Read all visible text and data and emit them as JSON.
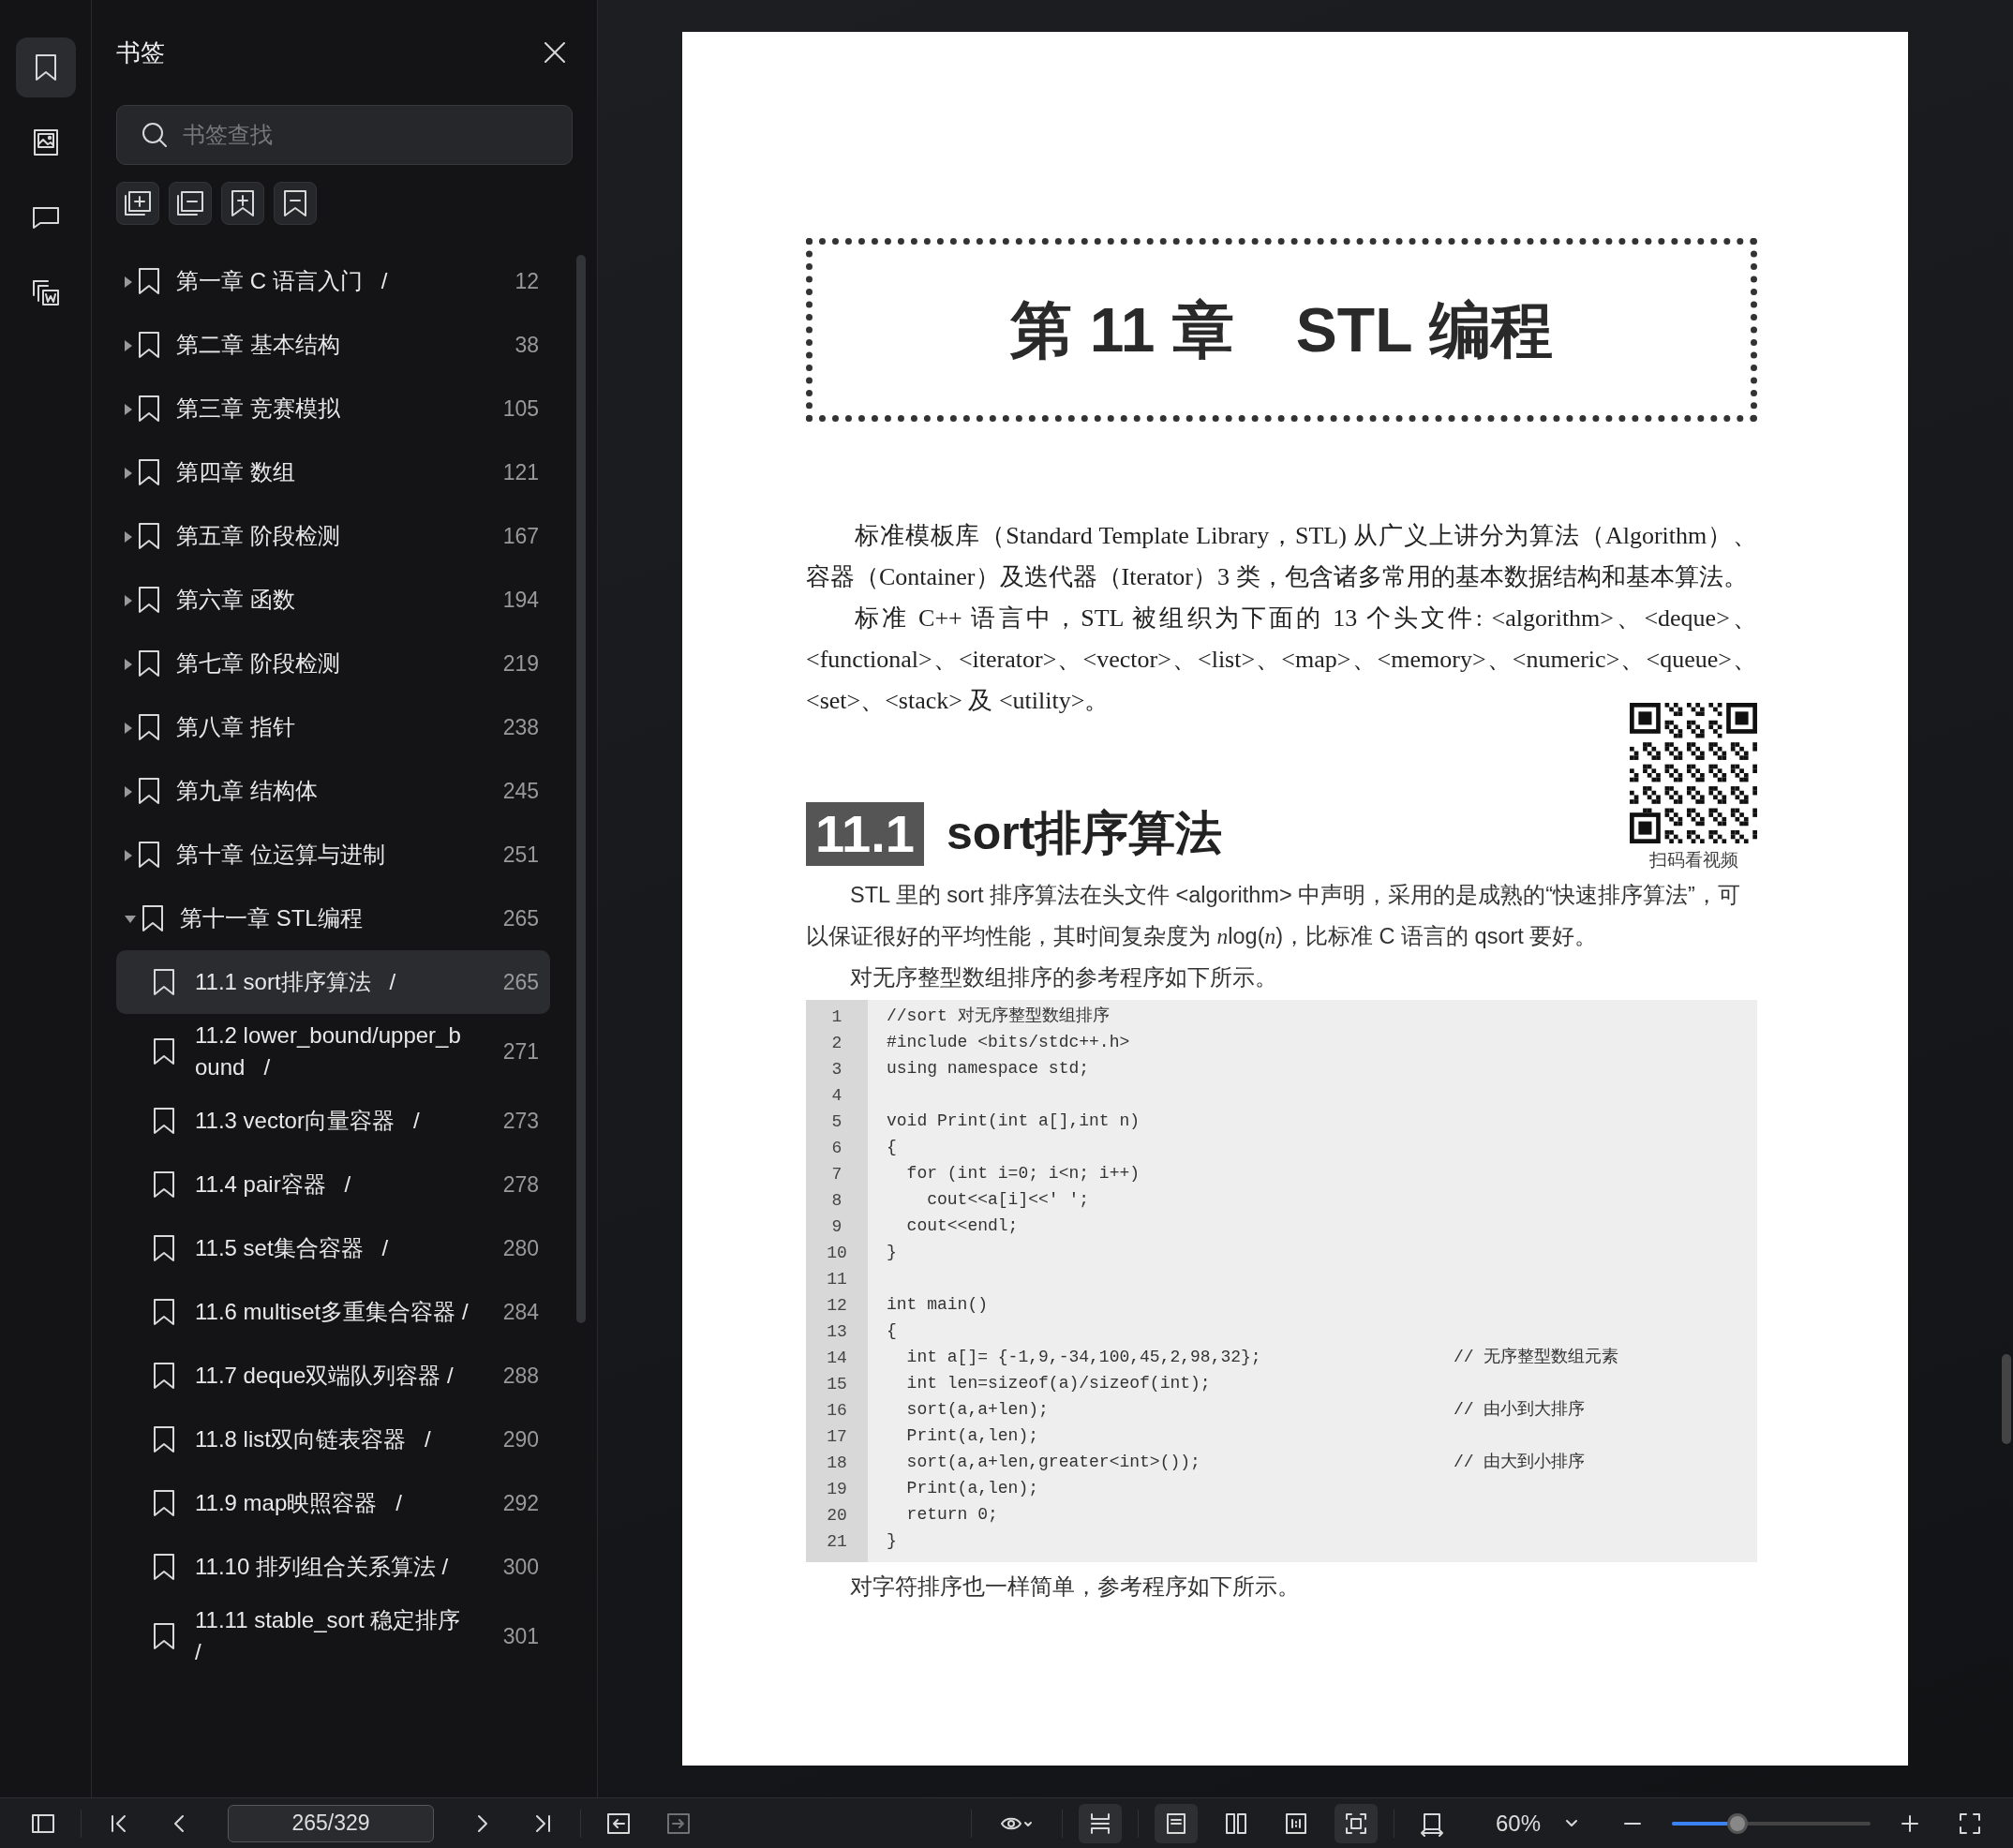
{
  "rail": [
    {
      "kind": "bookmark",
      "selected": true
    },
    {
      "kind": "image",
      "selected": false
    },
    {
      "kind": "comment",
      "selected": false
    },
    {
      "kind": "export",
      "selected": false
    }
  ],
  "sidebar": {
    "title": "书签",
    "search": {
      "placeholder": "书签查找"
    },
    "tools": [
      {
        "kind": "add-group"
      },
      {
        "kind": "remove-group"
      },
      {
        "kind": "add-bookmark"
      },
      {
        "kind": "remove-bookmark"
      }
    ],
    "items": [
      {
        "title": "第一章 C 语言入门   /",
        "page": "12",
        "expanded": false,
        "selected": false
      },
      {
        "title": "第二章 基本结构",
        "page": "38",
        "expanded": false,
        "selected": false
      },
      {
        "title": "第三章 竞赛模拟",
        "page": "105",
        "expanded": false,
        "selected": false
      },
      {
        "title": "第四章 数组",
        "page": "121",
        "expanded": false,
        "selected": false
      },
      {
        "title": "第五章 阶段检测",
        "page": "167",
        "expanded": false,
        "selected": false
      },
      {
        "title": "第六章 函数",
        "page": "194",
        "expanded": false,
        "selected": false
      },
      {
        "title": "第七章 阶段检测",
        "page": "219",
        "expanded": false,
        "selected": false
      },
      {
        "title": "第八章 指针",
        "page": "238",
        "expanded": false,
        "selected": false
      },
      {
        "title": "第九章 结构体",
        "page": "245",
        "expanded": false,
        "selected": false
      },
      {
        "title": "第十章 位运算与进制",
        "page": "251",
        "expanded": false,
        "selected": false
      },
      {
        "title": "第十一章 STL编程",
        "page": "265",
        "expanded": true,
        "selected": false,
        "children": [
          {
            "title": "11.1 sort排序算法   /",
            "page": "265",
            "selected": true
          },
          {
            "title": "11.2 lower_bound/upper_bound   /",
            "page": "271",
            "selected": false
          },
          {
            "title": "11.3 vector向量容器   /",
            "page": "273",
            "selected": false
          },
          {
            "title": "11.4 pair容器   /",
            "page": "278",
            "selected": false
          },
          {
            "title": "11.5 set集合容器   /",
            "page": "280",
            "selected": false
          },
          {
            "title": "11.6 multiset多重集合容器 /",
            "page": "284",
            "selected": false
          },
          {
            "title": "11.7 deque双端队列容器 /",
            "page": "288",
            "selected": false
          },
          {
            "title": "11.8 list双向链表容器   /",
            "page": "290",
            "selected": false
          },
          {
            "title": "11.9 map映照容器   /",
            "page": "292",
            "selected": false
          },
          {
            "title": "11.10 排列组合关系算法 /",
            "page": "300",
            "selected": false
          },
          {
            "title": "11.11 stable_sort 稳定排序 /",
            "page": "301",
            "selected": false
          }
        ]
      }
    ]
  },
  "page": {
    "chapter_title": "第 11 章　STL 编程",
    "paragraphs": [
      "标准模板库（Standard Template Library，STL) 从广义上讲分为算法（Algorithm）、容器（Container）及迭代器（Iterator）3 类，包含诸多常用的基本数据结构和基本算法。",
      "标准 C++ 语言中，STL 被组织为下面的 13 个头文件: <algorithm>、<deque>、<functional>、<iterator>、<vector>、<list>、<map>、<memory>、<numeric>、<queue>、<set>、<stack> 及 <utility>。"
    ],
    "section_number": "11.1",
    "section_title": "sort排序算法",
    "qr_caption": "扫码看视频",
    "body": [
      [
        {
          "text": "STL 里的 sort 排序算法在头文件 <algorithm> 中声明，采用的是成熟的“快速排序算法”，可以保证很好的平均性能，其时间复杂度为 "
        },
        {
          "text": "n",
          "italic": true
        },
        {
          "text": "log("
        },
        {
          "text": "n",
          "italic": true
        },
        {
          "text": ")，比标准 C 语言的 qsort 要好。"
        }
      ],
      [
        {
          "text": "对无序整型数组排序的参考程序如下所示。"
        }
      ]
    ],
    "code": [
      {
        "line": "1",
        "code": "//sort 对无序整型数组排序"
      },
      {
        "line": "2",
        "code": "#include <bits/stdc++.h>"
      },
      {
        "line": "3",
        "code": "using namespace std;"
      },
      {
        "line": "4"
      },
      {
        "line": "5",
        "code": "void Print(int a[],int n)"
      },
      {
        "line": "6",
        "code": "{"
      },
      {
        "line": "7",
        "code": "  for (int i=0; i<n; i++)"
      },
      {
        "line": "8",
        "code": "    cout<<a[i]<<' ';"
      },
      {
        "line": "9",
        "code": "  cout<<endl;"
      },
      {
        "line": "10",
        "code": "}"
      },
      {
        "line": "11"
      },
      {
        "line": "12",
        "code": "int main()"
      },
      {
        "line": "13",
        "code": "{"
      },
      {
        "line": "14",
        "code": "  int a[]= {-1,9,-34,100,45,2,98,32};",
        "comment": "// 无序整型数组元素"
      },
      {
        "line": "15",
        "code": "  int len=sizeof(a)/sizeof(int);"
      },
      {
        "line": "16",
        "code": "  sort(a,a+len);",
        "comment": "// 由小到大排序"
      },
      {
        "line": "17",
        "code": "  Print(a,len);"
      },
      {
        "line": "18",
        "code": "  sort(a,a+len,greater<int>());",
        "comment": "// 由大到小排序"
      },
      {
        "line": "19",
        "code": "  Print(a,len);"
      },
      {
        "line": "20",
        "code": "  return 0;"
      },
      {
        "line": "21",
        "code": "}"
      }
    ],
    "after": "对字符排序也一样简单，参考程序如下所示。"
  },
  "toolbar": {
    "items": [
      {
        "kind": "sidebar-toggle"
      },
      {
        "kind": "first"
      },
      {
        "kind": "prev"
      },
      {
        "kind": "page-field",
        "value": "265/329"
      },
      {
        "kind": "next"
      },
      {
        "kind": "last"
      },
      {
        "kind": "back",
        "disabled": false
      },
      {
        "kind": "forward",
        "disabled": true
      },
      {
        "kind": "eye"
      },
      {
        "kind": "scroll",
        "active": true
      },
      {
        "kind": "single",
        "active": true
      },
      {
        "kind": "double",
        "active": false
      },
      {
        "kind": "actual",
        "active": false
      },
      {
        "kind": "fit",
        "active": true
      },
      {
        "kind": "fit-width",
        "active": false
      },
      {
        "kind": "zoom",
        "value": "60%"
      },
      {
        "kind": "minus"
      },
      {
        "kind": "slider",
        "level": 0.33
      },
      {
        "kind": "plus"
      },
      {
        "kind": "fullscreen"
      }
    ]
  }
}
